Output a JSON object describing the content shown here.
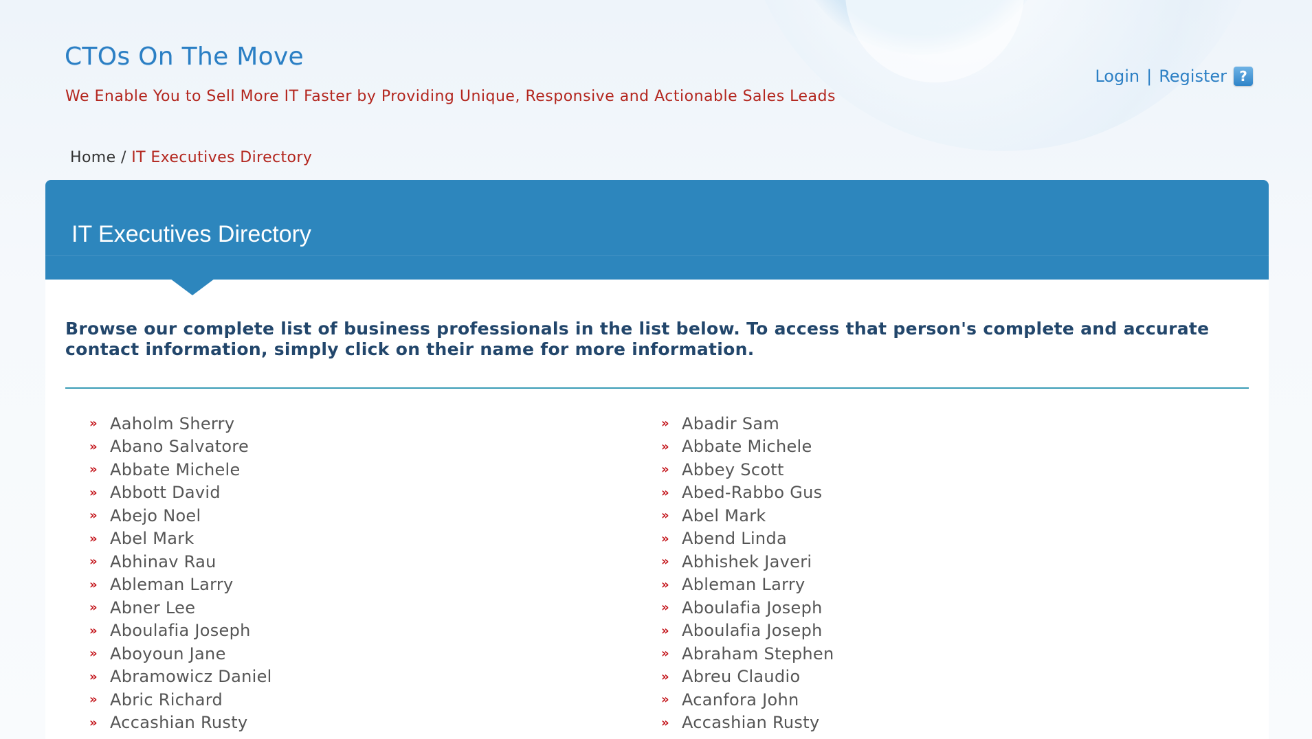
{
  "header": {
    "logo": "CTOs On The Move",
    "tagline": "We Enable You to Sell More IT Faster by Providing Unique, Responsive and Actionable Sales Leads",
    "login": "Login",
    "separator": "|",
    "register": "Register",
    "help_icon": "?"
  },
  "breadcrumb": {
    "home": "Home",
    "separator": "/",
    "current": "IT Executives Directory"
  },
  "panel": {
    "title": "IT Executives Directory",
    "intro": "Browse our complete list of business professionals in the list below. To access that person's complete and accurate contact information, simply click on their name for more information."
  },
  "bullet": "»",
  "directory": {
    "left": [
      "Aaholm Sherry",
      "Abano Salvatore",
      "Abbate Michele",
      "Abbott David",
      "Abejo Noel",
      "Abel Mark",
      "Abhinav Rau",
      "Ableman Larry",
      "Abner Lee",
      "Aboulafia Joseph",
      "Aboyoun Jane",
      "Abramowicz Daniel",
      "Abric Richard",
      "Accashian Rusty"
    ],
    "right": [
      "Abadir Sam",
      "Abbate Michele",
      "Abbey Scott",
      "Abed-Rabbo Gus",
      "Abel Mark",
      "Abend Linda",
      "Abhishek Javeri",
      "Ableman Larry",
      "Aboulafia Joseph",
      "Aboulafia Joseph",
      "Abraham Stephen",
      "Abreu Claudio",
      "Acanfora John",
      "Accashian Rusty"
    ]
  },
  "colors": {
    "brand_blue": "#2b7fc4",
    "panel_header": "#2d86bd",
    "accent_red": "#b3261e",
    "bullet_red": "#c4161c",
    "intro_text": "#22466b",
    "rule": "#3a9cb6"
  }
}
